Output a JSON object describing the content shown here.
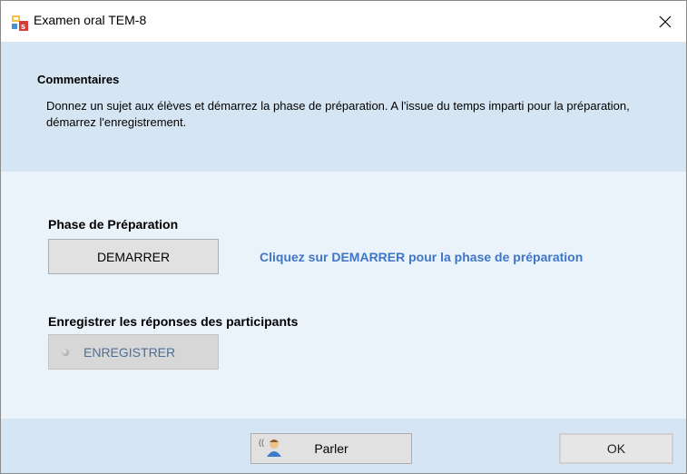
{
  "window": {
    "title": "Examen oral TEM-8"
  },
  "comments": {
    "title": "Commentaires",
    "text": "Donnez un sujet aux élèves et démarrez la phase de préparation. A l'issue du temps imparti pour la préparation, démarrez l'enregistrement."
  },
  "preparation": {
    "label": "Phase de Préparation",
    "start_button": "DEMARRER",
    "hint": "Cliquez sur DEMARRER pour la phase de préparation"
  },
  "recording": {
    "label": "Enregistrer les réponses des participants",
    "record_button": "ENREGISTRER"
  },
  "footer": {
    "talk_button": "Parler",
    "ok_button": "OK"
  },
  "colors": {
    "comment_panel": "#d6e5f3",
    "main_panel": "#eaf2fa",
    "hint_text": "#3f76c6"
  }
}
